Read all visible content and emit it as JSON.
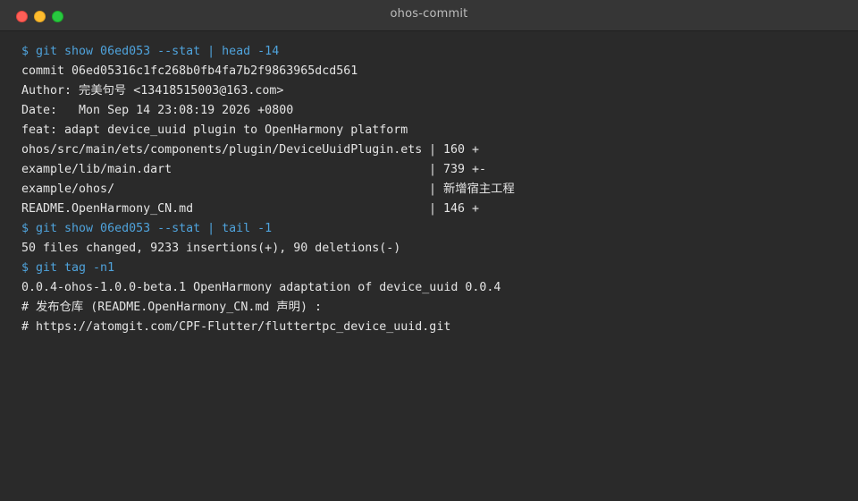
{
  "window": {
    "title": "ohos-commit"
  },
  "terminal": {
    "cmd1": "$ git show 06ed053 --stat | head -14",
    "commit": "commit 06ed05316c1fc268b0fb4fa7b2f9863965dcd561",
    "author": "Author: 完美句号 <13418515003@163.com>",
    "date": "Date:   Mon Sep 14 23:08:19 2026 +0800",
    "message": "feat: adapt device_uuid plugin to OpenHarmony platform",
    "stats": [
      {
        "path": "ohos/src/main/ets/components/plugin/DeviceUuidPlugin.ets",
        "sep": "|",
        "count": "160 +"
      },
      {
        "path": "example/lib/main.dart",
        "sep": "|",
        "count": "739 +-"
      },
      {
        "path": "example/ohos/",
        "sep": "|",
        "count": "新增宿主工程"
      },
      {
        "path": "README.OpenHarmony_CN.md",
        "sep": "|",
        "count": "146 +"
      }
    ],
    "cmd2": "$ git show 06ed053 --stat | tail -1",
    "summary": "50 files changed, 9233 insertions(+), 90 deletions(-)",
    "cmd3": "$ git tag -n1",
    "tag": "0.0.4-ohos-1.0.0-beta.1 OpenHarmony adaptation of device_uuid 0.0.4",
    "comment1": "# 发布仓库 (README.OpenHarmony_CN.md 声明) :",
    "comment2": "# https://atomgit.com/CPF-Flutter/fluttertpc_device_uuid.git"
  }
}
